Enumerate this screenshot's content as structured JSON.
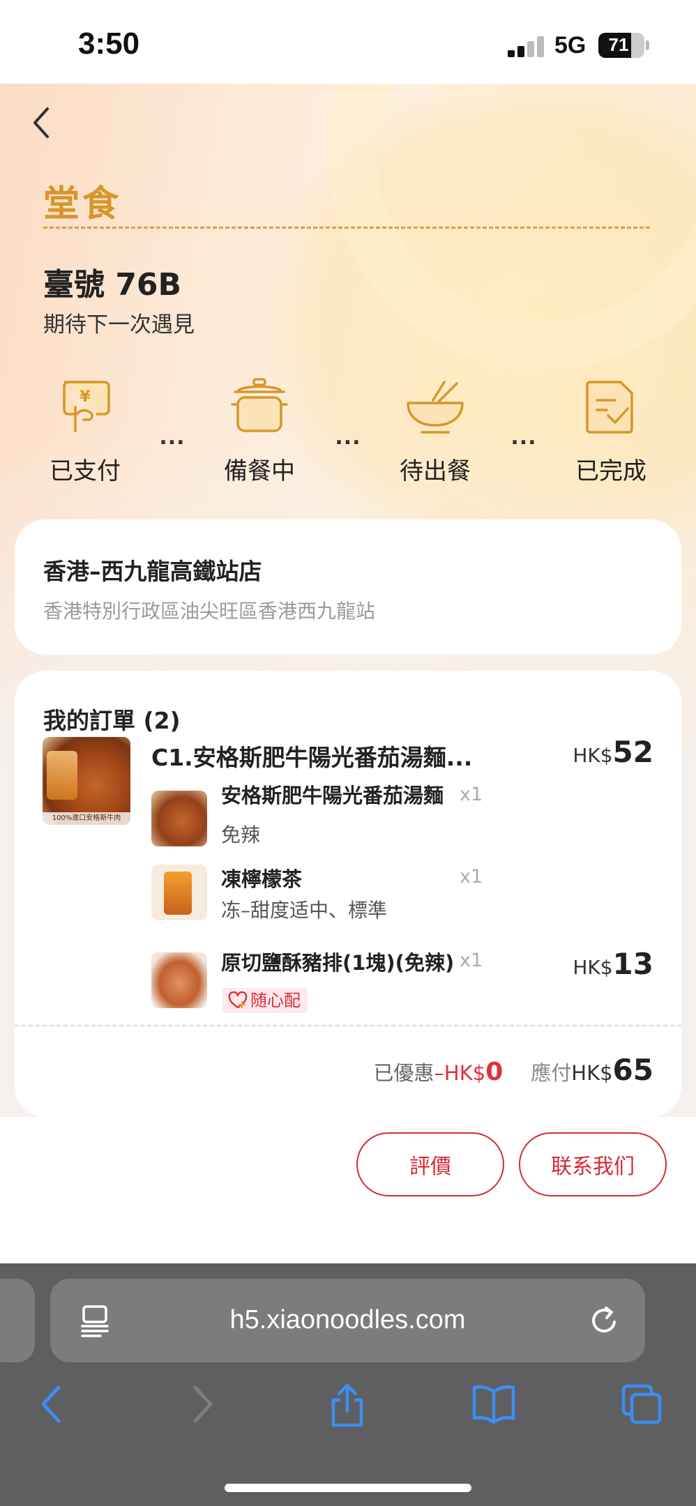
{
  "status_bar": {
    "time": "3:50",
    "network": "5G",
    "battery": "71",
    "battery_level": 0.71
  },
  "header": {
    "title": "堂食",
    "table_number": "臺號 76B",
    "greeting": "期待下一次遇見"
  },
  "progress": {
    "steps": [
      {
        "label": "已支付",
        "icon": "payment-icon"
      },
      {
        "label": "備餐中",
        "icon": "pot-icon"
      },
      {
        "label": "待出餐",
        "icon": "bowl-icon"
      },
      {
        "label": "已完成",
        "icon": "document-check-icon"
      }
    ],
    "separator": "..."
  },
  "store": {
    "name": "香港–西九龍高鐵站店",
    "address": "香港特別行政區油尖旺區香港西九龍站"
  },
  "order": {
    "title": "我的訂單 (2)",
    "combo": {
      "name": "C1.安格斯肥牛陽光番茄湯麵...",
      "currency": "HK$",
      "price": "52",
      "image_tag": "100%進口安格斯牛肉",
      "items": [
        {
          "name": "安格斯肥牛陽光番茄湯麵",
          "qty": "x1",
          "note": "免辣"
        },
        {
          "name": "凍檸檬茶",
          "qty": "x1",
          "note": "冻–甜度适中、標準"
        }
      ]
    },
    "extra": {
      "name": "原切鹽酥豬排(1塊)(免辣)",
      "qty": "x1",
      "tag": "随心配",
      "currency": "HK$",
      "price": "13"
    },
    "summary": {
      "discount_label": "已優惠",
      "discount_currency": "–HK$",
      "discount_value": "0",
      "payable_label": "應付",
      "payable_currency": "HK$",
      "payable_value": "65"
    }
  },
  "actions": {
    "review": "評價",
    "contact": "联系我们"
  },
  "browser": {
    "url": "h5.xiaonoodles.com"
  },
  "colors": {
    "accent_red": "#d52a34",
    "title_gold": "#d8962a",
    "browser_blue": "#3b8ef5"
  }
}
